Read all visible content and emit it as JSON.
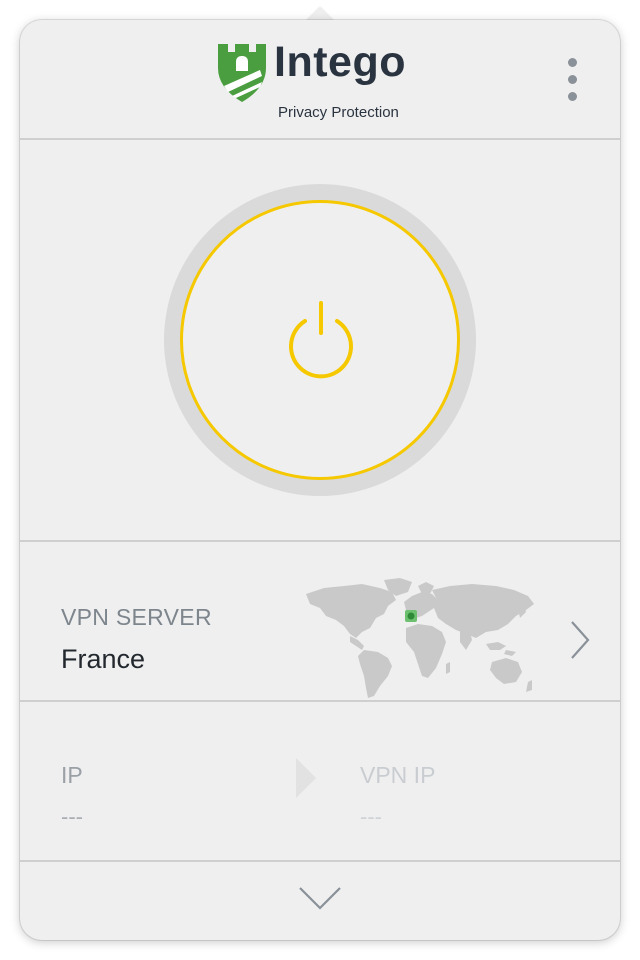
{
  "header": {
    "brand_name": "Intego",
    "brand_tagline": "Privacy Protection",
    "logo_icon": "castle-tower-icon",
    "menu_icon": "vertical-dots-icon"
  },
  "power": {
    "icon": "power-icon",
    "ring_color": "#f5c800"
  },
  "server": {
    "label": "VPN SERVER",
    "value": "France",
    "map_icon": "world-map-icon",
    "highlight_color": "#4caf50",
    "chevron_icon": "chevron-right-icon"
  },
  "ip": {
    "label": "IP",
    "value": "---",
    "vpn_label": "VPN IP",
    "vpn_value": "---",
    "arrow_icon": "arrow-right-icon"
  },
  "footer": {
    "chevron_icon": "chevron-down-icon"
  },
  "colors": {
    "accent": "#f5c800",
    "brand_green": "#4a9e3f",
    "text_dark": "#22282e",
    "text_muted": "#7d858d"
  }
}
